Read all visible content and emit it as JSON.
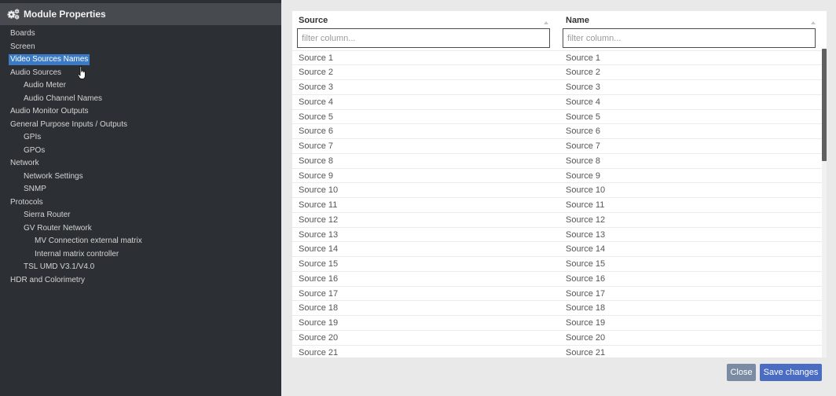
{
  "sidebar": {
    "title": "Module Properties",
    "title_icon": "cogs-icon",
    "tree": [
      {
        "label": "Boards"
      },
      {
        "label": "Screen"
      },
      {
        "label": "Video Sources Names",
        "selected": true
      },
      {
        "label": "Audio Sources",
        "children": [
          {
            "label": "Audio Meter"
          },
          {
            "label": "Audio Channel Names"
          }
        ]
      },
      {
        "label": "Audio Monitor Outputs"
      },
      {
        "label": "General Purpose Inputs / Outputs",
        "children": [
          {
            "label": "GPIs"
          },
          {
            "label": "GPOs"
          }
        ]
      },
      {
        "label": "Network",
        "children": [
          {
            "label": "Network Settings"
          },
          {
            "label": "SNMP"
          }
        ]
      },
      {
        "label": "Protocols",
        "children": [
          {
            "label": "Sierra Router"
          },
          {
            "label": "GV Router Network",
            "children": [
              {
                "label": "MV Connection external matrix"
              },
              {
                "label": "Internal matrix controller"
              }
            ]
          },
          {
            "label": "TSL UMD V3.1/V4.0"
          }
        ]
      },
      {
        "label": "HDR and Colorimetry"
      }
    ]
  },
  "cursor": {
    "icon": "hand-pointer-icon"
  },
  "table": {
    "columns": [
      {
        "label": "Source",
        "filter_placeholder": "filter column...",
        "filter_value": "",
        "sort_icon": "sort-asc-icon"
      },
      {
        "label": "Name",
        "filter_placeholder": "filter column...",
        "filter_value": "",
        "sort_icon": "sort-asc-icon"
      }
    ],
    "rows": [
      {
        "source": "Source 1",
        "name": "Source 1"
      },
      {
        "source": "Source 2",
        "name": "Source 2"
      },
      {
        "source": "Source 3",
        "name": "Source 3"
      },
      {
        "source": "Source 4",
        "name": "Source 4"
      },
      {
        "source": "Source 5",
        "name": "Source 5"
      },
      {
        "source": "Source 6",
        "name": "Source 6"
      },
      {
        "source": "Source 7",
        "name": "Source 7"
      },
      {
        "source": "Source 8",
        "name": "Source 8"
      },
      {
        "source": "Source 9",
        "name": "Source 9"
      },
      {
        "source": "Source 10",
        "name": "Source 10"
      },
      {
        "source": "Source 11",
        "name": "Source 11"
      },
      {
        "source": "Source 12",
        "name": "Source 12"
      },
      {
        "source": "Source 13",
        "name": "Source 13"
      },
      {
        "source": "Source 14",
        "name": "Source 14"
      },
      {
        "source": "Source 15",
        "name": "Source 15"
      },
      {
        "source": "Source 16",
        "name": "Source 16"
      },
      {
        "source": "Source 17",
        "name": "Source 17"
      },
      {
        "source": "Source 18",
        "name": "Source 18"
      },
      {
        "source": "Source 19",
        "name": "Source 19"
      },
      {
        "source": "Source 20",
        "name": "Source 20"
      },
      {
        "source": "Source 21",
        "name": "Source 21"
      }
    ]
  },
  "footer": {
    "close_label": "Close",
    "save_label": "Save changes"
  },
  "colors": {
    "page_background": "#e9e9e9",
    "sidebar_background": "#2c3034",
    "sidebar_header": "#474b4f",
    "selection": "#3b7ac4",
    "close_button": "#7b8ba4",
    "save_button": "#4a6dc3"
  }
}
